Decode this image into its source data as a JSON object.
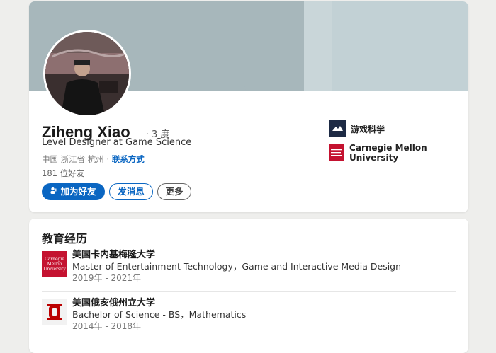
{
  "profile": {
    "name": "Ziheng Xiao",
    "degree": "· 3 度",
    "headline": "Level Designer at Game Science",
    "location_prefix": "中国 浙江省 杭州 ·",
    "contact_label": "联系方式",
    "friends": "181 位好友",
    "buttons": {
      "add_friend": "加为好友",
      "message": "发消息",
      "more": "更多"
    },
    "orgs": [
      {
        "name": "游戏科学",
        "icon": "game-science-logo"
      },
      {
        "name": "Carnegie Mellon University",
        "icon": "cmu-logo"
      }
    ]
  },
  "education": {
    "title": "教育经历",
    "items": [
      {
        "school": "美国卡内基梅隆大学",
        "degree": "Master of Entertainment Technology，Game and Interactive Media Design",
        "years": "2019年 - 2021年",
        "logo_text": "Carnegie Mellon University",
        "icon": "cmu-logo"
      },
      {
        "school": "美国俄亥俄州立大学",
        "degree": "Bachelor of Science - BS，Mathematics",
        "years": "2014年 - 2018年",
        "icon": "ohio-state-logo"
      }
    ]
  },
  "colors": {
    "accent": "#0a66c2",
    "cmu_red": "#c41230",
    "osu_red": "#bb0000"
  }
}
